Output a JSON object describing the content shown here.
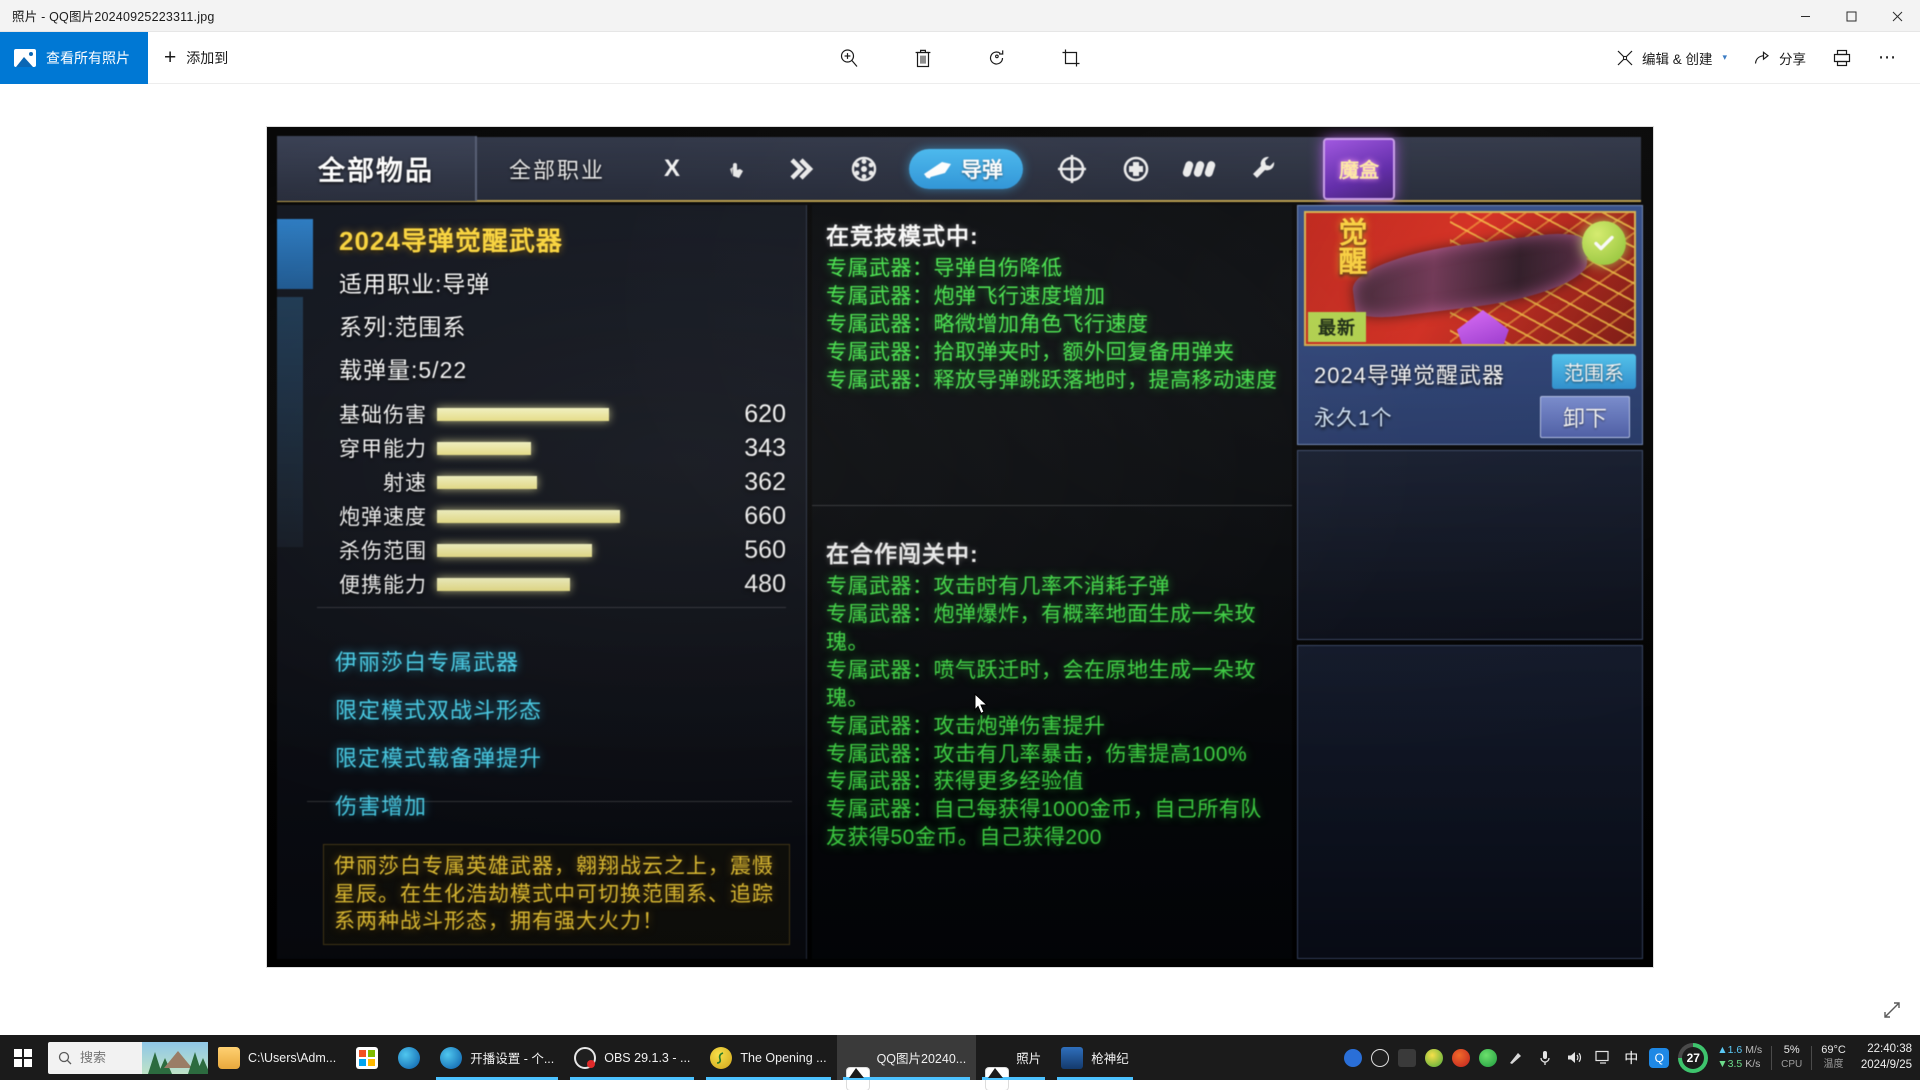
{
  "window": {
    "title": "照片 - QQ图片20240925223311.jpg",
    "minimize": "minimize-icon",
    "maximize": "maximize-icon",
    "close": "close-icon"
  },
  "toolbar": {
    "view_all_label": "查看所有照片",
    "add_to_label": "添加到",
    "zoom_icon": "zoom-in-icon",
    "delete_icon": "trash-icon",
    "rotate_icon": "rotate-icon",
    "crop_icon": "crop-icon",
    "edit_create_label": "编辑 & 创建",
    "edit_create_caret": "⌄",
    "share_label": "分享",
    "print_icon": "printer-icon",
    "more_label": "⋯"
  },
  "photo": {
    "game_header": {
      "tab_all_items": "全部物品",
      "tab_all_jobs": "全部职业",
      "class_icons": [
        "x-icon",
        "hand-icon",
        "double-chevron-icon",
        "grenade-icon"
      ],
      "selected_tab": "导弹",
      "right_icons": [
        "crosshair-icon",
        "medkit-icon",
        "bullets-icon",
        "wrench-icon"
      ],
      "magic_box": "魔盒"
    },
    "weapon": {
      "title": "2024导弹觉醒武器",
      "attributes": [
        "适用职业:导弹",
        "系列:范围系",
        "载弹量:5/22"
      ],
      "stats": [
        {
          "name": "基础伤害",
          "value": "620",
          "pct": 62
        },
        {
          "name": "穿甲能力",
          "value": "343",
          "pct": 34
        },
        {
          "name": "射速",
          "value": "362",
          "pct": 36
        },
        {
          "name": "炮弹速度",
          "value": "660",
          "pct": 66
        },
        {
          "name": "杀伤范围",
          "value": "560",
          "pct": 56
        },
        {
          "name": "便携能力",
          "value": "480",
          "pct": 48
        }
      ],
      "perks": [
        "伊丽莎白专属武器",
        "限定模式双战斗形态",
        "限定模式载备弹提升",
        "伤害增加"
      ],
      "description": "伊丽莎白专属英雄武器，翱翔战云之上，震慑星辰。在生化浩劫模式中可切换范围系、追踪系两种战斗形态，拥有强大火力！"
    },
    "competitive": {
      "heading": "在竞技模式中:",
      "lines": [
        "专属武器：导弹自伤降低",
        "专属武器：炮弹飞行速度增加",
        "专属武器：略微增加角色飞行速度",
        "专属武器：拾取弹夹时，额外回复备用弹夹",
        "专属武器：释放导弹跳跃落地时，提高移动速度"
      ]
    },
    "coop": {
      "heading": "在合作闯关中:",
      "lines": [
        "专属武器：攻击时有几率不消耗子弹",
        "专属武器：炮弹爆炸，有概率地面生成一朵玫瑰。",
        "专属武器：喷气跃迁时，会在原地生成一朵玫瑰。",
        "专属武器：攻击炮弹伤害提升",
        "专属武器：攻击有几率暴击，伤害提高100%",
        "专属武器：获得更多经验值",
        "专属武器：自己每获得1000金币，自己所有队友获得50金币。自己获得200"
      ]
    },
    "inventory": {
      "awaken_label": "觉醒",
      "new_badge": "最新",
      "check_icon": "check-icon",
      "item_name": "2024导弹觉醒武器",
      "item_count": "永久1个",
      "series_tag": "范围系",
      "unequip_label": "卸下"
    }
  },
  "taskbar": {
    "start_icon": "windows-start-icon",
    "search_placeholder": "搜索",
    "search_icon": "search-icon",
    "items": [
      {
        "label": "C:\\Users\\Adm...",
        "icon": "folder-icon"
      },
      {
        "label": "",
        "icon": "microsoft-store-icon"
      },
      {
        "label": "",
        "icon": "edge-icon"
      },
      {
        "label": "开播设置 - 个...",
        "icon": "edge-icon"
      },
      {
        "label": "OBS 29.1.3 - ...",
        "icon": "obs-icon"
      },
      {
        "label": "The Opening ...",
        "icon": "music-icon"
      },
      {
        "label": "QQ图片20240...",
        "icon": "photos-icon"
      },
      {
        "label": "照片",
        "icon": "photos-icon"
      },
      {
        "label": "枪神纪",
        "icon": "game-icon"
      }
    ],
    "tray": {
      "icons": [
        "shield-icon",
        "obs-tray-icon",
        "nvidia-icon",
        "music-tray-icon",
        "opera-icon",
        "antivirus-icon",
        "sound-device-icon",
        "microphone-icon",
        "volume-icon",
        "display-icon"
      ],
      "ime": "中",
      "q_app": "Q",
      "gauge_value": "27",
      "net_up": "1.6",
      "net_up_unit": "M/s",
      "net_down": "3.5",
      "net_down_unit": "K/s",
      "cpu_value": "5%",
      "cpu_label": "CPU",
      "temp_value": "69°C",
      "temp_label": "温度",
      "time": "22:40:38",
      "date": "2024/9/25"
    }
  },
  "colors": {
    "accent": "#0078d4",
    "gold": "#ffd83a",
    "cyan": "#4fe2ff",
    "green": "#44e84a"
  }
}
